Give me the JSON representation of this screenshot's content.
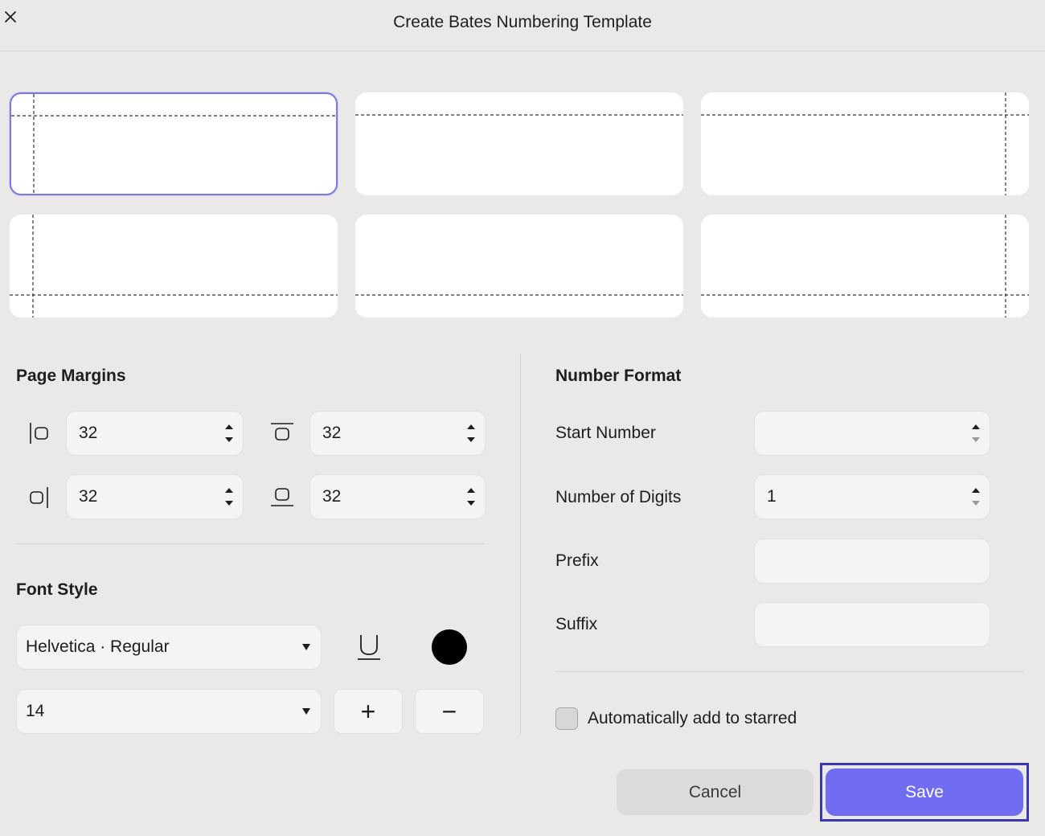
{
  "dialog": {
    "title": "Create Bates Numbering Template"
  },
  "icons": {
    "close": "close-icon"
  },
  "positions": [
    "top-left",
    "top-center",
    "top-right",
    "bottom-left",
    "bottom-center",
    "bottom-right"
  ],
  "page_margins": {
    "heading": "Page Margins",
    "left": "32",
    "top": "32",
    "right": "32",
    "bottom": "32"
  },
  "font_style": {
    "heading": "Font Style",
    "font": "Helvetica · Regular",
    "size": "14",
    "increase": "+",
    "decrease": "−",
    "color": "#000000"
  },
  "number_format": {
    "heading": "Number Format",
    "start_label": "Start Number",
    "start_value": "",
    "digits_label": "Number of Digits",
    "digits_value": "1",
    "prefix_label": "Prefix",
    "prefix_value": "",
    "suffix_label": "Suffix",
    "suffix_value": ""
  },
  "starred": {
    "label": "Automatically add to starred",
    "checked": false
  },
  "actions": {
    "cancel": "Cancel",
    "save": "Save"
  },
  "colors": {
    "accent": "#716df2",
    "selected_border": "#7b78e8",
    "background": "#ebe9e8"
  }
}
